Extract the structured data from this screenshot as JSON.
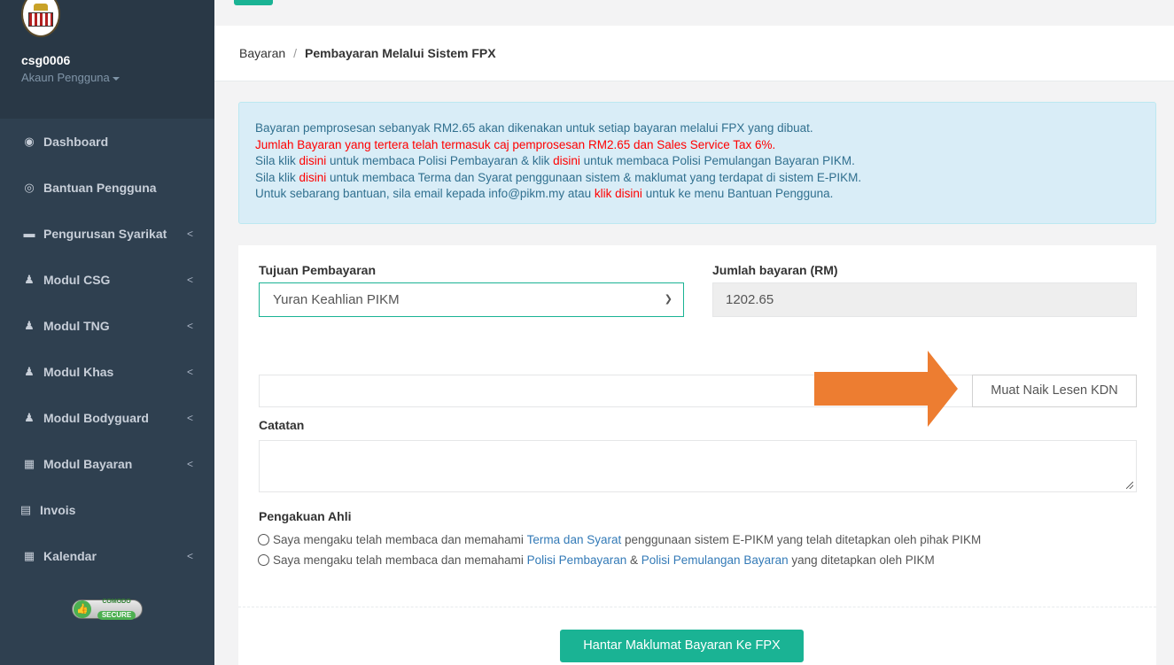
{
  "sidebar": {
    "username": "csg0006",
    "account_label": "Akaun Pengguna",
    "items": [
      {
        "label": "Dashboard",
        "icon": "tachometer-icon",
        "glyph": "◉",
        "has_submenu": false
      },
      {
        "label": "Bantuan Pengguna",
        "icon": "life-ring-icon",
        "glyph": "◎",
        "has_submenu": false
      },
      {
        "label": "Pengurusan Syarikat",
        "icon": "briefcase-icon",
        "glyph": "▬",
        "has_submenu": true
      },
      {
        "label": "Modul CSG",
        "icon": "users-icon",
        "glyph": "♟",
        "has_submenu": true
      },
      {
        "label": "Modul TNG",
        "icon": "users-icon",
        "glyph": "♟",
        "has_submenu": true
      },
      {
        "label": "Modul Khas",
        "icon": "users-icon",
        "glyph": "♟",
        "has_submenu": true
      },
      {
        "label": "Modul Bodyguard",
        "icon": "users-icon",
        "glyph": "♟",
        "has_submenu": true
      },
      {
        "label": "Modul Bayaran",
        "icon": "calculator-icon",
        "glyph": "▦",
        "has_submenu": true
      },
      {
        "label": "Invois",
        "icon": "file-icon",
        "glyph": "▤",
        "has_submenu": false
      },
      {
        "label": "Kalendar",
        "icon": "calendar-icon",
        "glyph": "▦",
        "has_submenu": true
      }
    ],
    "chevron": "<",
    "comodo": {
      "top": "COMODO",
      "bottom": "SECURE"
    }
  },
  "breadcrumb": {
    "parent": "Bayaran",
    "separator": "/",
    "current": "Pembayaran Melalui Sistem FPX"
  },
  "notice": {
    "line1": "Bayaran pemprosesan sebanyak RM2.65 akan dikenakan untuk setiap bayaran melalui FPX yang dibuat.",
    "line2": "Jumlah Bayaran yang tertera telah termasuk caj pemprosesan RM2.65 dan Sales Service Tax 6%.",
    "line3_a": "Sila klik ",
    "line3_link1": "disini",
    "line3_b": " untuk membaca Polisi Pembayaran & klik ",
    "line3_link2": "disini",
    "line3_c": " untuk membaca Polisi Pemulangan Bayaran PIKM.",
    "line4_a": "Sila klik ",
    "line4_link": "disini",
    "line4_b": " untuk membaca Terma dan Syarat penggunaan sistem & maklumat yang terdapat di sistem E-PIKM.",
    "line5_a": "Untuk sebarang bantuan, sila email kepada info@pikm.my atau ",
    "line5_link": "klik disini",
    "line5_b": " untuk ke menu Bantuan Pengguna."
  },
  "form": {
    "purpose_label": "Tujuan Pembayaran",
    "purpose_value": "Yuran Keahlian PIKM",
    "amount_label": "Jumlah bayaran (RM)",
    "amount_value": "1202.65",
    "upload_button": "Muat Naik Lesen KDN",
    "notes_label": "Catatan",
    "declaration_label": "Pengakuan Ahli",
    "decl1_a": "Saya mengaku telah membaca dan memahami ",
    "decl1_link": "Terma dan Syarat",
    "decl1_b": " penggunaan sistem E-PIKM yang telah ditetapkan oleh pihak PIKM",
    "decl2_a": "Saya mengaku telah membaca dan memahami ",
    "decl2_link1": "Polisi Pembayaran",
    "decl2_amp": " & ",
    "decl2_link2": "Polisi Pemulangan Bayaran",
    "decl2_b": " yang ditetapkan oleh PIKM",
    "submit_button": "Hantar Maklumat Bayaran Ke FPX"
  },
  "colors": {
    "sidebar_bg": "#2f4050",
    "accent": "#1ab394",
    "alert_bg": "#d9edf7",
    "arrow": "#ed7d31"
  }
}
